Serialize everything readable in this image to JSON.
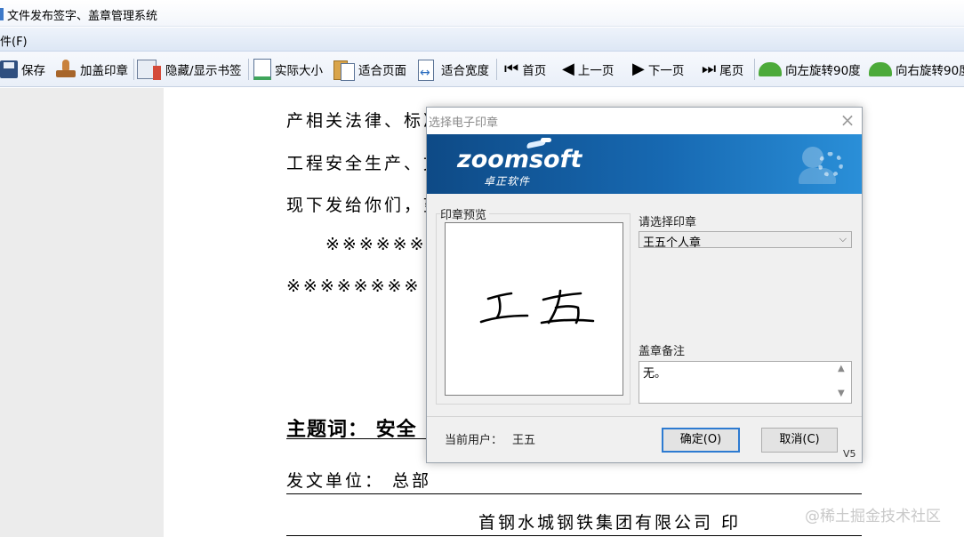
{
  "window": {
    "title": "文件发布签字、盖章管理系统"
  },
  "menu": {
    "file": "件(F)"
  },
  "toolbar": {
    "save": "保存",
    "stamp": "加盖印章",
    "toggle_bookmarks": "隐藏/显示书签",
    "actual_size": "实际大小",
    "fit_page": "适合页面",
    "fit_width": "适合宽度",
    "first_page": "首页",
    "prev_page": "上一页",
    "next_page": "下一页",
    "last_page": "尾页",
    "rotate_left": "向左旋转90度",
    "rotate_right": "向右旋转90度"
  },
  "document": {
    "line1": "产相关法律、标准",
    "line2": "工程安全生产、文",
    "line3": "现下发给你们，望",
    "line4": "※※※※※※",
    "line5": "※※※※※※※※",
    "subject": "主题词：  安全",
    "issuer": "发文单位：  总部",
    "company": "首钢水城钢铁集团有限公司     印"
  },
  "watermark": "@稀土掘金技术社区",
  "dialog": {
    "title": "选择电子印章",
    "close": "×",
    "logo_name": "zoomsoft",
    "logo_sub": "卓正软件",
    "preview_label": "印章预览",
    "seal_signature": "王五",
    "select_label": "请选择印章",
    "selected_seal": "王五个人章",
    "remark_label": "盖章备注",
    "remark_value": "无。",
    "current_user_label": "当前用户：",
    "current_user": "王五",
    "ok": "确定(O)",
    "cancel": "取消(C)",
    "version": "V5"
  },
  "colors": {
    "banner": "#1769b2",
    "primary_border": "#2d7bd1",
    "dialog_bg": "#f0f0f0"
  }
}
